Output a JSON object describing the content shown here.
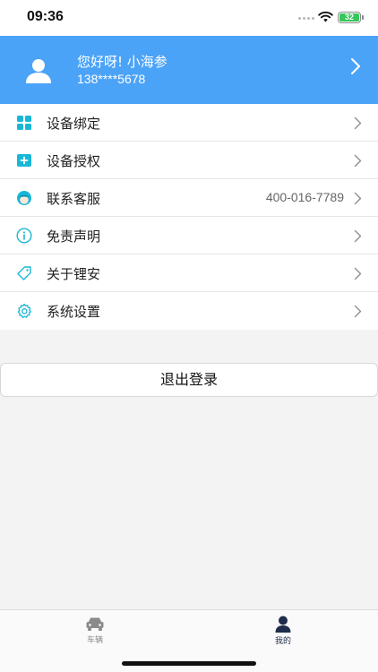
{
  "status_bar": {
    "time": "09:36",
    "battery": "32"
  },
  "profile": {
    "greeting": "您好呀! 小海参",
    "phone": "138****5678",
    "bg_color": "#4ba3f8"
  },
  "menu": {
    "items": [
      {
        "label": "设备绑定",
        "icon": "grid-icon"
      },
      {
        "label": "设备授权",
        "icon": "plus-square-icon"
      },
      {
        "label": "联系客服",
        "icon": "customer-service-icon",
        "value": "400-016-7789"
      },
      {
        "label": "免责声明",
        "icon": "info-icon"
      },
      {
        "label": "关于锂安",
        "icon": "tag-icon"
      },
      {
        "label": "系统设置",
        "icon": "gear-icon"
      }
    ]
  },
  "logout": {
    "label": "退出登录"
  },
  "tabbar": {
    "tabs": [
      {
        "label": "车辆",
        "icon": "car-icon",
        "active": false
      },
      {
        "label": "我的",
        "icon": "user-icon",
        "active": true
      }
    ]
  },
  "colors": {
    "accent": "#4ba3f8",
    "icon_teal": "#19b7d6",
    "tab_active": "#1f2d4a"
  }
}
